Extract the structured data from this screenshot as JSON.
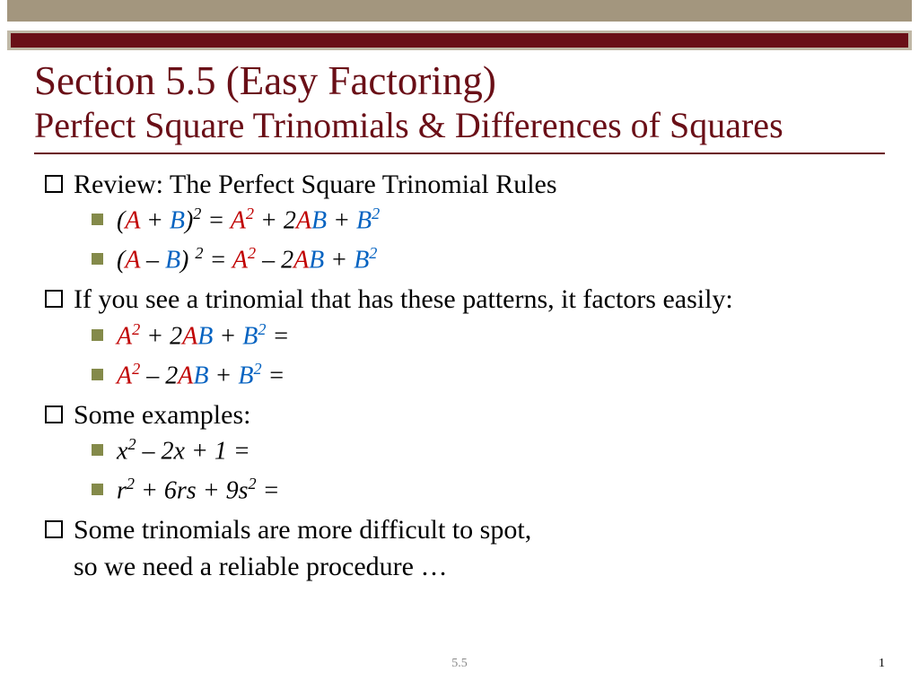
{
  "title": {
    "line1": "Section 5.5  (Easy Factoring)",
    "line2": "Perfect Square Trinomials & Differences of Squares"
  },
  "body": {
    "item1": "Review:  The Perfect Square Trinomial Rules",
    "item1_sub": [
      {
        "segments": [
          {
            "t": "(",
            "c": ""
          },
          {
            "t": "A",
            "c": "red"
          },
          {
            "t": " + ",
            "c": ""
          },
          {
            "t": "B",
            "c": "blue"
          },
          {
            "t": ")",
            "c": ""
          },
          {
            "t": "2",
            "c": "",
            "sup": true
          },
          {
            "t": " = ",
            "c": ""
          },
          {
            "t": "A",
            "c": "red"
          },
          {
            "t": "2",
            "c": "red",
            "sup": true
          },
          {
            "t": " + 2",
            "c": ""
          },
          {
            "t": "A",
            "c": "red"
          },
          {
            "t": "B",
            "c": "blue"
          },
          {
            "t": " + ",
            "c": ""
          },
          {
            "t": "B",
            "c": "blue"
          },
          {
            "t": "2",
            "c": "blue",
            "sup": true
          }
        ]
      },
      {
        "segments": [
          {
            "t": "(",
            "c": ""
          },
          {
            "t": "A",
            "c": "red"
          },
          {
            "t": " – ",
            "c": ""
          },
          {
            "t": "B",
            "c": "blue"
          },
          {
            "t": ") ",
            "c": ""
          },
          {
            "t": "2",
            "c": "",
            "sup": true
          },
          {
            "t": " = ",
            "c": ""
          },
          {
            "t": "A",
            "c": "red"
          },
          {
            "t": "2",
            "c": "red",
            "sup": true
          },
          {
            "t": " – 2",
            "c": ""
          },
          {
            "t": "A",
            "c": "red"
          },
          {
            "t": "B",
            "c": "blue"
          },
          {
            "t": " + ",
            "c": ""
          },
          {
            "t": "B",
            "c": "blue"
          },
          {
            "t": "2",
            "c": "blue",
            "sup": true
          }
        ]
      }
    ],
    "item2": "If you see a trinomial that has these patterns, it factors easily:",
    "item2_sub": [
      {
        "segments": [
          {
            "t": "A",
            "c": "red"
          },
          {
            "t": "2",
            "c": "red",
            "sup": true
          },
          {
            "t": " + 2",
            "c": ""
          },
          {
            "t": "A",
            "c": "red"
          },
          {
            "t": "B",
            "c": "blue"
          },
          {
            "t": " + ",
            "c": ""
          },
          {
            "t": "B",
            "c": "blue"
          },
          {
            "t": "2",
            "c": "blue",
            "sup": true
          },
          {
            "t": " = ",
            "c": ""
          }
        ]
      },
      {
        "segments": [
          {
            "t": "A",
            "c": "red"
          },
          {
            "t": "2",
            "c": "red",
            "sup": true
          },
          {
            "t": " – 2",
            "c": ""
          },
          {
            "t": "A",
            "c": "red"
          },
          {
            "t": "B",
            "c": "blue"
          },
          {
            "t": " + ",
            "c": ""
          },
          {
            "t": "B",
            "c": "blue"
          },
          {
            "t": "2",
            "c": "blue",
            "sup": true
          },
          {
            "t": " = ",
            "c": ""
          }
        ]
      }
    ],
    "item3": "Some examples:",
    "item3_sub": [
      {
        "segments": [
          {
            "t": "x",
            "c": ""
          },
          {
            "t": "2",
            "c": "",
            "sup": true
          },
          {
            "t": " – 2x + 1 = ",
            "c": ""
          }
        ]
      },
      {
        "segments": [
          {
            "t": "r",
            "c": ""
          },
          {
            "t": "2",
            "c": "",
            "sup": true
          },
          {
            "t": " + 6rs + 9s",
            "c": ""
          },
          {
            "t": "2",
            "c": "",
            "sup": true
          },
          {
            "t": " = ",
            "c": ""
          }
        ]
      }
    ],
    "item4_line1": "Some trinomials are more difficult to spot,",
    "item4_line2": "so we need a reliable procedure …"
  },
  "footer": {
    "pagenum": "1",
    "center": "5.5"
  }
}
